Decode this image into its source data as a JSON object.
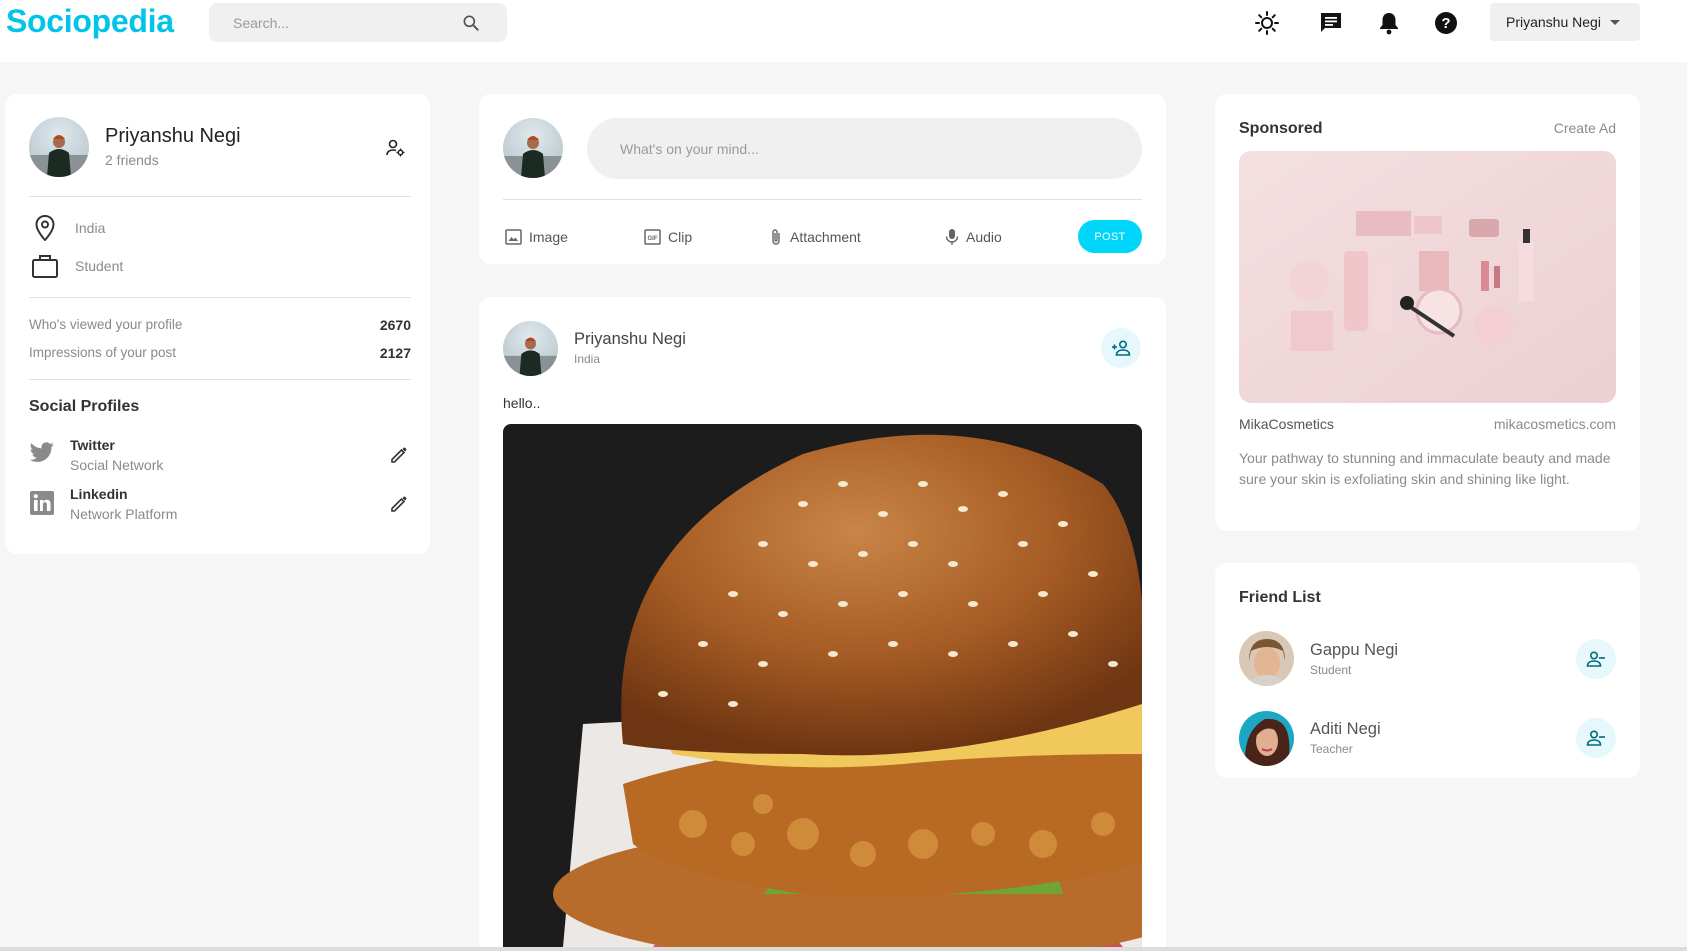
{
  "app": {
    "logo": "Sociopedia"
  },
  "navbar": {
    "search_placeholder": "Search...",
    "icons": [
      "light-mode-icon",
      "message-icon",
      "notification-bell-icon",
      "help-icon"
    ],
    "user_name": "Priyanshu Negi"
  },
  "profile": {
    "name": "Priyanshu Negi",
    "friends": "2 friends",
    "location": "India",
    "occupation": "Student",
    "viewed_label": "Who's viewed your profile",
    "viewed_value": "2670",
    "impressions_label": "Impressions of your post",
    "impressions_value": "2127",
    "social_title": "Social Profiles",
    "socials": [
      {
        "name": "Twitter",
        "type": "Social Network"
      },
      {
        "name": "Linkedin",
        "type": "Network Platform"
      }
    ]
  },
  "composer": {
    "placeholder": "What's on your mind...",
    "actions": [
      "Image",
      "Clip",
      "Attachment",
      "Audio"
    ],
    "post_label": "POST"
  },
  "post": {
    "author": "Priyanshu Negi",
    "location": "India",
    "text": "hello.."
  },
  "sponsored": {
    "title": "Sponsored",
    "create_ad": "Create Ad",
    "brand": "MikaCosmetics",
    "url": "mikacosmetics.com",
    "description": "Your pathway to stunning and immaculate beauty and made sure your skin is exfoliating skin and shining like light."
  },
  "friend_list": {
    "title": "Friend List",
    "friends": [
      {
        "name": "Gappu Negi",
        "role": "Student"
      },
      {
        "name": "Aditi Negi",
        "role": "Teacher"
      }
    ]
  },
  "colors": {
    "brand": "#00c4e8",
    "post_button": "#00d5fa",
    "icon_bg": "#e6f8fb",
    "icon_fg": "#006b7d"
  }
}
